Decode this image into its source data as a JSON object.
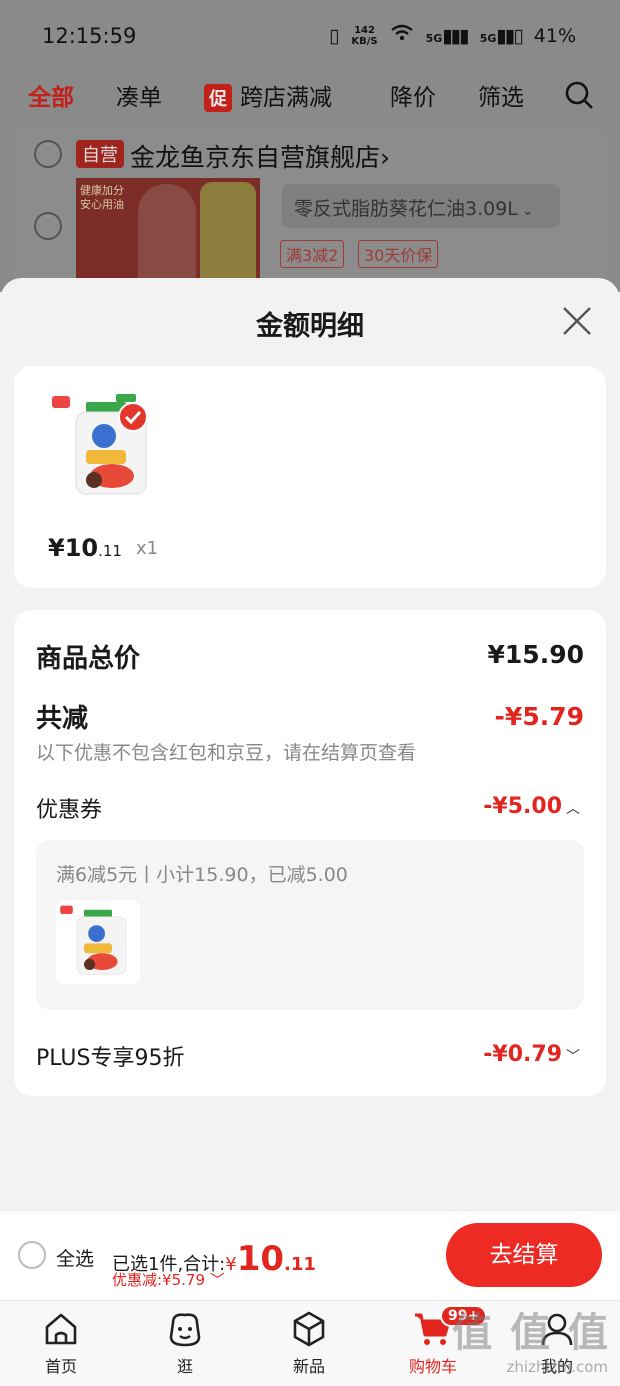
{
  "status_bar": {
    "time": "12:15:59",
    "net_speed_value": "142",
    "net_speed_unit": "KB/S",
    "signal1": "5G",
    "signal2": "5G",
    "battery": "41%"
  },
  "filter_tabs": [
    "全部",
    "凑单",
    "跨店满减",
    "降价",
    "筛选"
  ],
  "promo_icon_text": "促",
  "store": {
    "tag": "自营",
    "name": "金龙鱼京东自营旗舰店",
    "chevron": "›",
    "product_spec": "零反式脂肪葵花仁油3.09L",
    "promo_tags": [
      "满3减2",
      "30天价保"
    ],
    "banner_text": "健康加分 安心用油"
  },
  "sheet": {
    "title": "金额明细",
    "item": {
      "price_main": "¥10",
      "price_cents": ".11",
      "qty": "x1"
    },
    "total_label": "商品总价",
    "total_value": "¥15.90",
    "reduce_label": "共减",
    "reduce_value": "-¥5.79",
    "reduce_note": "以下优惠不包含红包和京豆，请在结算页查看",
    "coupon_label": "优惠券",
    "coupon_value": "-¥5.00",
    "coupon_detail": "满6减5元丨小计15.90，已减5.00",
    "plus_label": "PLUS专享95折",
    "plus_value": "-¥0.79"
  },
  "checkout": {
    "select_all": "全选",
    "selected_text": "已选1件,合计:",
    "currency": "¥",
    "total_main": "10",
    "total_cents": ".11",
    "discount_text": "优惠减:¥5.79",
    "pay_button": "去结算"
  },
  "tabbar": {
    "items": [
      "首页",
      "逛",
      "新品",
      "购物车",
      "我的"
    ],
    "cart_badge": "99+"
  },
  "watermark": {
    "logo": "值 值 值",
    "url": "zhizhizhi.com"
  },
  "colors": {
    "accent": "#e2261f",
    "button": "#ee2a24"
  }
}
